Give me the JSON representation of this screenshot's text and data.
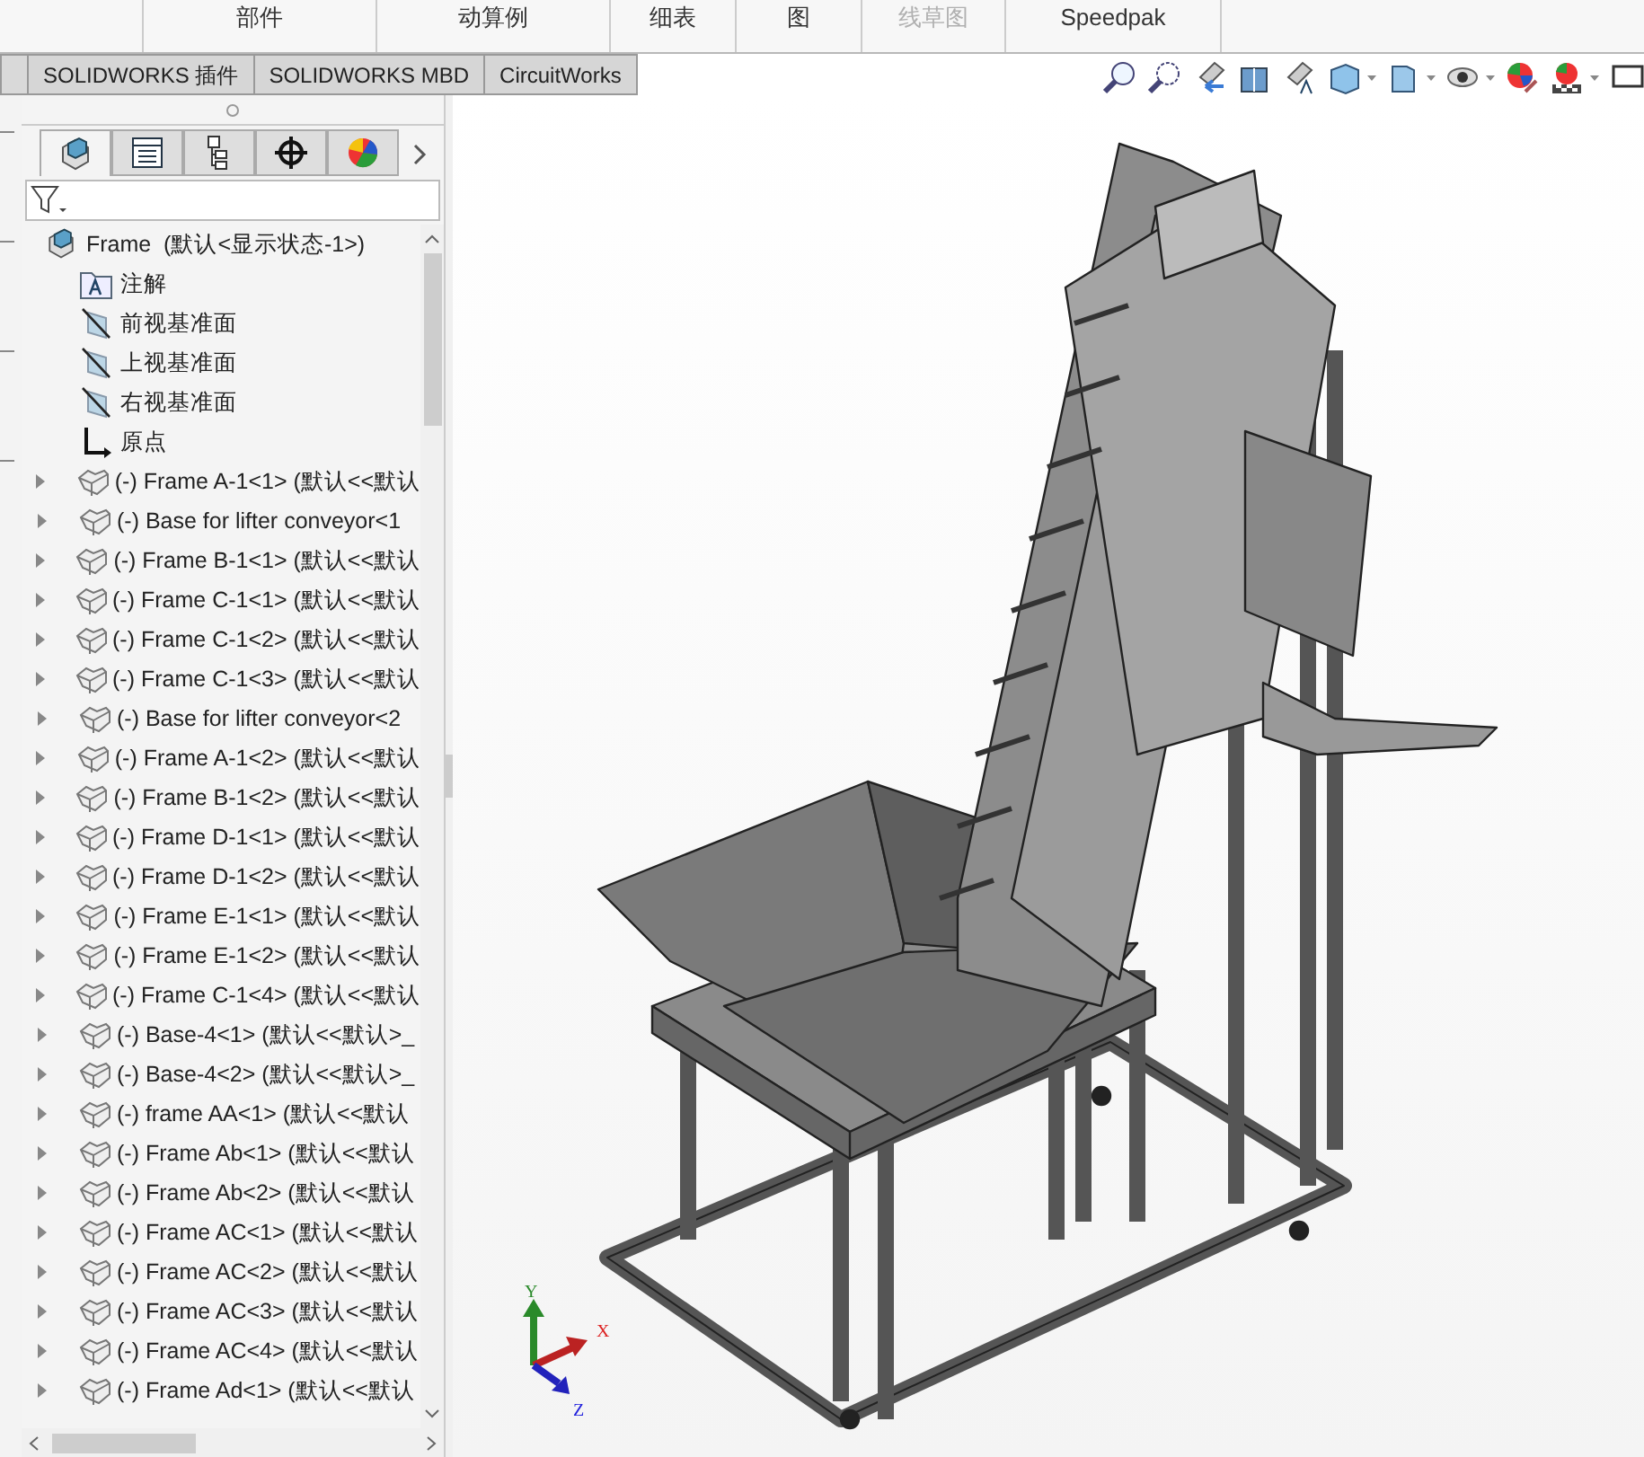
{
  "ribbon": {
    "labels": [
      {
        "text": "部件",
        "disabled": false
      },
      {
        "text": "动算例",
        "disabled": false
      },
      {
        "text": "细表",
        "disabled": false
      },
      {
        "text": "图",
        "disabled": false
      },
      {
        "text": "线草图",
        "disabled": true
      },
      {
        "text": "Speedpak",
        "disabled": false
      }
    ]
  },
  "tabs": [
    {
      "label": "SOLIDWORKS 插件",
      "selected": false
    },
    {
      "label": "SOLIDWORKS MBD",
      "selected": false
    },
    {
      "label": "CircuitWorks",
      "selected": false
    }
  ],
  "panel_tabs": [
    {
      "kind": "feature-tree",
      "selected": true
    },
    {
      "kind": "property",
      "selected": false
    },
    {
      "kind": "config",
      "selected": false
    },
    {
      "kind": "dimxpert",
      "selected": false
    },
    {
      "kind": "appearance",
      "selected": false
    }
  ],
  "tree": {
    "label": "Frame",
    "suffix": "(默认<显示状态-1>)",
    "expanded": true,
    "children": [
      {
        "kind": "annotations",
        "label": "注解"
      },
      {
        "kind": "plane",
        "label": "前视基准面"
      },
      {
        "kind": "plane",
        "label": "上视基准面"
      },
      {
        "kind": "plane",
        "label": "右视基准面"
      },
      {
        "kind": "origin",
        "label": "原点"
      },
      {
        "kind": "part",
        "label": "(-) Frame A-1<1> (默认<<默认",
        "expanded": false
      },
      {
        "kind": "part",
        "label": "(-) Base for lifter conveyor<1",
        "expanded": false
      },
      {
        "kind": "part",
        "label": "(-) Frame B-1<1> (默认<<默认",
        "expanded": false
      },
      {
        "kind": "part",
        "label": "(-) Frame C-1<1> (默认<<默认",
        "expanded": false
      },
      {
        "kind": "part",
        "label": "(-) Frame C-1<2> (默认<<默认",
        "expanded": false
      },
      {
        "kind": "part",
        "label": "(-) Frame C-1<3> (默认<<默认",
        "expanded": false
      },
      {
        "kind": "part",
        "label": "(-) Base for lifter conveyor<2",
        "expanded": false
      },
      {
        "kind": "part",
        "label": "(-) Frame A-1<2> (默认<<默认",
        "expanded": false
      },
      {
        "kind": "part",
        "label": "(-) Frame B-1<2> (默认<<默认",
        "expanded": false
      },
      {
        "kind": "part",
        "label": "(-) Frame D-1<1> (默认<<默认",
        "expanded": false
      },
      {
        "kind": "part",
        "label": "(-) Frame D-1<2> (默认<<默认",
        "expanded": false
      },
      {
        "kind": "part",
        "label": "(-) Frame E-1<1> (默认<<默认",
        "expanded": false
      },
      {
        "kind": "part",
        "label": "(-) Frame E-1<2> (默认<<默认",
        "expanded": false
      },
      {
        "kind": "part",
        "label": "(-) Frame C-1<4> (默认<<默认",
        "expanded": false
      },
      {
        "kind": "part",
        "label": "(-) Base-4<1> (默认<<默认>_",
        "expanded": false
      },
      {
        "kind": "part",
        "label": "(-) Base-4<2> (默认<<默认>_",
        "expanded": false
      },
      {
        "kind": "part",
        "label": "(-) frame AA<1> (默认<<默认",
        "expanded": false
      },
      {
        "kind": "part",
        "label": "(-) Frame Ab<1> (默认<<默认",
        "expanded": false
      },
      {
        "kind": "part",
        "label": "(-) Frame Ab<2> (默认<<默认",
        "expanded": false
      },
      {
        "kind": "part",
        "label": "(-) Frame AC<1> (默认<<默认",
        "expanded": false
      },
      {
        "kind": "part",
        "label": "(-) Frame AC<2> (默认<<默认",
        "expanded": false
      },
      {
        "kind": "part",
        "label": "(-) Frame AC<3> (默认<<默认",
        "expanded": false
      },
      {
        "kind": "part",
        "label": "(-) Frame AC<4> (默认<<默认",
        "expanded": false
      },
      {
        "kind": "part",
        "label": "(-) Frame Ad<1> (默认<<默认",
        "expanded": false
      }
    ]
  },
  "triad": {
    "x": "X",
    "y": "Y",
    "z": "Z"
  }
}
